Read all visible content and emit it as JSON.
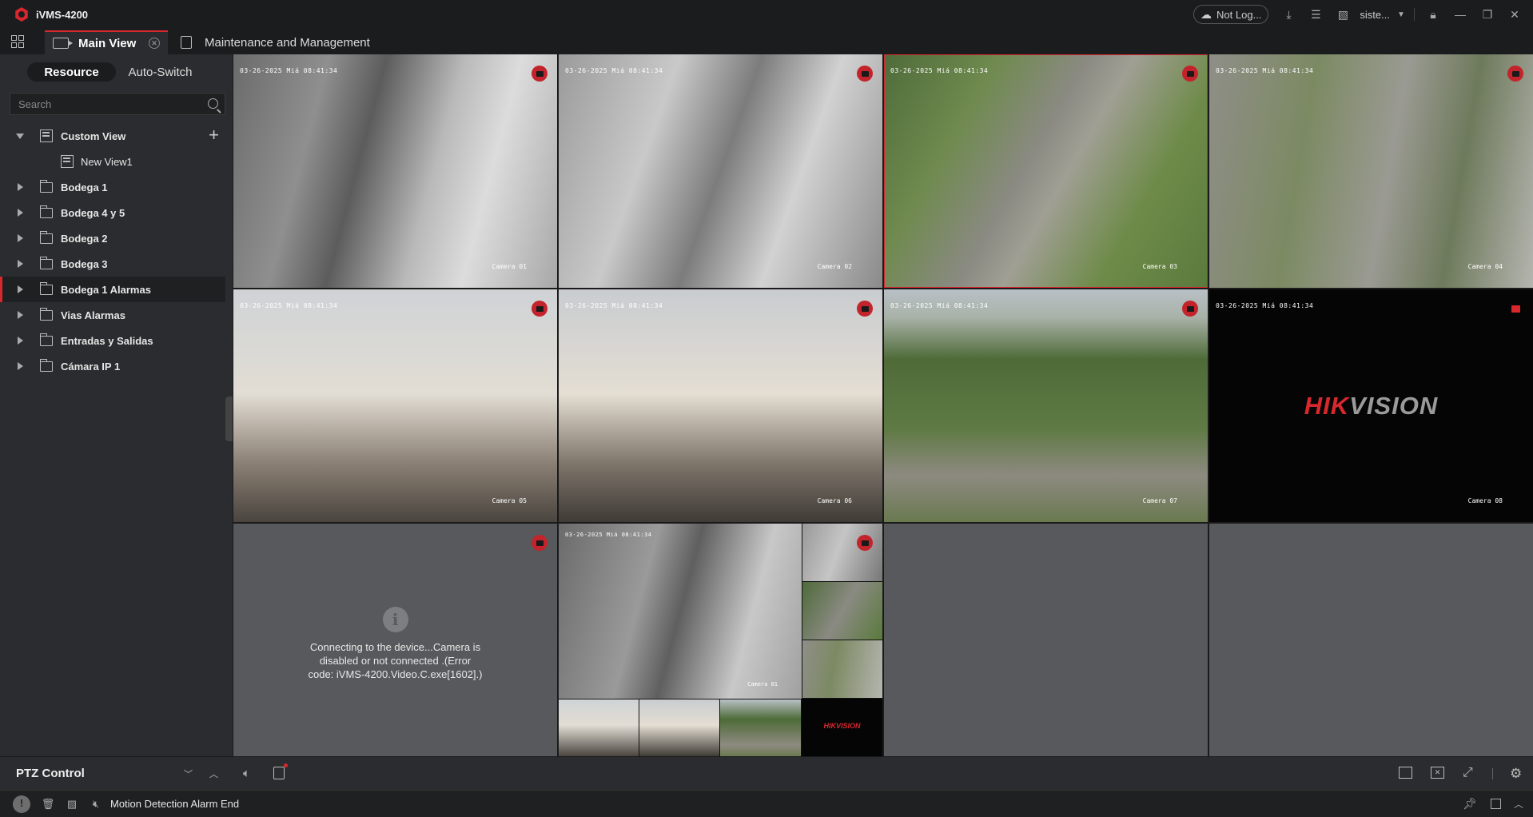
{
  "app": {
    "title": "iVMS-4200",
    "brand_color": "#d8282e"
  },
  "titlebar": {
    "cloud_label": "Not Log...",
    "user_label": "siste...",
    "icons": [
      "cloud-icon",
      "download-icon",
      "task-list-icon",
      "image-icon",
      "chevron-down-icon",
      "lock-icon",
      "minimize-icon",
      "restore-icon",
      "close-icon"
    ]
  },
  "tabs": {
    "main": "Main View",
    "maintenance": "Maintenance and Management"
  },
  "sidebar": {
    "seg_resource": "Resource",
    "seg_autoswitch": "Auto-Switch",
    "search_placeholder": "Search",
    "custom_view": "Custom View",
    "new_view": "New View1",
    "items": [
      "Bodega 1",
      "Bodega 4 y 5",
      "Bodega 2",
      "Bodega 3",
      "Bodega 1 Alarmas",
      "Vias Alarmas",
      "Entradas y Salidas",
      "Cámara IP 1"
    ],
    "selected_index": 4
  },
  "ptz": {
    "label": "PTZ Control"
  },
  "cameras": [
    {
      "timestamp": "03-26-2025 Miá 08:41:34",
      "name": "Camera 01"
    },
    {
      "timestamp": "03-26-2025 Miá 08:41:34",
      "name": "Camera 02"
    },
    {
      "timestamp": "03-26-2025 Miá 08:41:34",
      "name": "Camera 03"
    },
    {
      "timestamp": "03-26-2025 Miá 08:41:34",
      "name": "Camera 04"
    },
    {
      "timestamp": "03-26-2025 Miá 08:41:34",
      "name": "Camera 05"
    },
    {
      "timestamp": "03-26-2025 Miá 08:41:34",
      "name": "Camera 06"
    },
    {
      "timestamp": "03-26-2025 Miá 08:41:34",
      "name": "Camera 07"
    },
    {
      "timestamp": "03-26-2025 Miá 08:41:34",
      "name": "Camera 08",
      "logo_red": "HIK",
      "logo_gray": "VISION"
    }
  ],
  "multi_cell": {
    "timestamp": "03-26-2025 Miá 08:41:34",
    "name": "Camera 01",
    "logo": "HIKVISION"
  },
  "error_cell": {
    "line1": "Connecting to the device...Camera is",
    "line2": "disabled or not connected .(Error",
    "line3": "code: iVMS-4200.Video.C.exe[1602].)"
  },
  "status": {
    "message": "Motion Detection Alarm End"
  }
}
